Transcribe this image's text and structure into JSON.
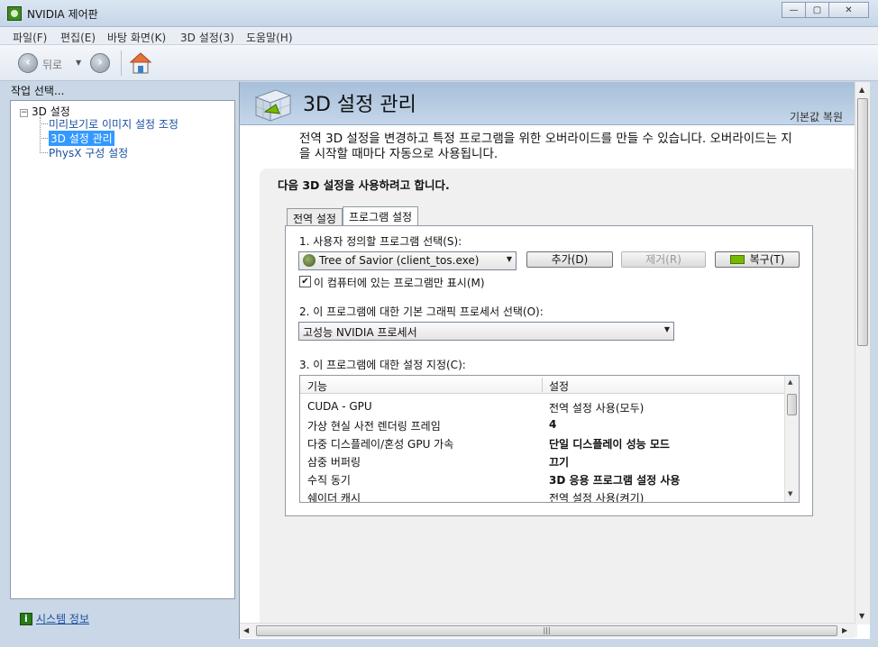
{
  "window": {
    "title": "NVIDIA 제어판",
    "minimize": "—",
    "maximize": "▢",
    "close": "✕"
  },
  "menu": [
    "파일(F)",
    "편집(E)",
    "바탕 화면(K)",
    "3D 설정(3)",
    "도움말(H)"
  ],
  "toolbar": {
    "back_label": "뒤로"
  },
  "left": {
    "header": "작업 선택...",
    "tree_root": "3D 설정",
    "tree_items": [
      "미리보기로 이미지 설정 조정",
      "3D 설정 관리",
      "PhysX 구성 설정"
    ],
    "selected_index": 1,
    "system_info": "시스템 정보"
  },
  "main": {
    "title": "3D 설정 관리",
    "restore_defaults": "기본값 복원",
    "intro_line1": "전역 3D 설정을 변경하고 특정 프로그램을 위한 오버라이드를 만들 수 있습니다. 오버라이드는 지",
    "intro_line2": "을 시작할 때마다 자동으로 사용됩니다.",
    "panel_heading": "다음 3D 설정을 사용하려고 합니다.",
    "tabs": [
      "전역 설정",
      "프로그램 설정"
    ],
    "active_tab": 1,
    "step1_label": "1. 사용자 정의할 프로그램 선택(S):",
    "program_value": "Tree of Savior (client_tos.exe)",
    "add_button": "추가(D)",
    "remove_button": "제거(R)",
    "restore_button": "복구(T)",
    "show_only_checkbox": "이 컴퓨터에 있는 프로그램만 표시(M)",
    "show_only_checked": true,
    "step2_label": "2. 이 프로그램에 대한 기본 그래픽 프로세서 선택(O):",
    "processor_value": "고성능 NVIDIA 프로세서",
    "step3_label": "3. 이 프로그램에 대한 설정 지정(C):",
    "grid_headers": [
      "기능",
      "설정"
    ],
    "grid_rows": [
      {
        "feature": "CUDA - GPU",
        "setting": "전역 설정 사용(모두)",
        "bold": false
      },
      {
        "feature": "가상 현실 사전 렌더링 프레임",
        "setting": "4",
        "bold": true
      },
      {
        "feature": "다중 디스플레이/혼성 GPU 가속",
        "setting": "단일 디스플레이 성능 모드",
        "bold": true
      },
      {
        "feature": "삼중 버퍼링",
        "setting": "끄기",
        "bold": true
      },
      {
        "feature": "수직 동기",
        "setting": "3D 응용 프로그램 설정 사용",
        "bold": true
      },
      {
        "feature": "쉐이더 캐시",
        "setting": "전역 설정 사용(켜기)",
        "bold": false
      }
    ]
  },
  "colors": {
    "selection": "#3399ff",
    "banner": "#b4c9e0",
    "nvidia_green": "#76b900"
  }
}
